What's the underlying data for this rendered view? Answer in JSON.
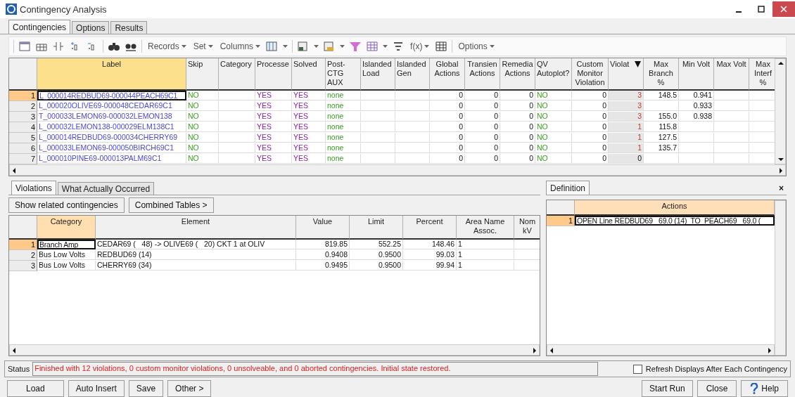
{
  "window": {
    "title": "Contingency Analysis"
  },
  "tabs": [
    {
      "label": "Contingencies",
      "selected": true
    },
    {
      "label": "Options",
      "selected": false
    },
    {
      "label": "Results",
      "selected": false
    }
  ],
  "toolbar": {
    "menus": [
      "Records",
      "Set",
      "Columns",
      "f(x)",
      "Options"
    ]
  },
  "contingencies": {
    "columns": [
      {
        "label": "Label",
        "kind": "label",
        "selected": true,
        "sorted": false
      },
      {
        "label": "Skip",
        "kind": "flag",
        "selected": false,
        "sorted": false
      },
      {
        "label": "Category",
        "kind": "text",
        "selected": false,
        "sorted": false
      },
      {
        "label": "Processe",
        "kind": "status",
        "selected": false,
        "sorted": false
      },
      {
        "label": "Solved",
        "kind": "status",
        "selected": false,
        "sorted": false
      },
      {
        "label": "Post-CTG AUX",
        "kind": "flag",
        "selected": false,
        "sorted": false
      },
      {
        "label": "Islanded Load",
        "kind": "text",
        "selected": false,
        "sorted": false
      },
      {
        "label": "Islanded Gen",
        "kind": "text",
        "selected": false,
        "sorted": false
      },
      {
        "label": "Global Actions",
        "kind": "num",
        "selected": false,
        "sorted": false
      },
      {
        "label": "Transien Actions",
        "kind": "num",
        "selected": false,
        "sorted": false
      },
      {
        "label": "Remedia Actions",
        "kind": "num",
        "selected": false,
        "sorted": false
      },
      {
        "label": "QV Autoplot?",
        "kind": "flag",
        "selected": false,
        "sorted": false
      },
      {
        "label": "Custom Monitor Violation",
        "kind": "num",
        "selected": false,
        "sorted": false
      },
      {
        "label": "Violat",
        "kind": "count",
        "selected": false,
        "sorted": true
      },
      {
        "label": "Max Branch %",
        "kind": "num",
        "selected": false,
        "sorted": false
      },
      {
        "label": "Min Volt",
        "kind": "num",
        "selected": false,
        "sorted": false
      },
      {
        "label": "Max Volt",
        "kind": "num",
        "selected": false,
        "sorted": false
      },
      {
        "label": "Max Interf %",
        "kind": "num",
        "selected": false,
        "sorted": false
      }
    ],
    "rows": [
      {
        "number": "1",
        "selected": true,
        "violated": true,
        "cells": [
          "L_000014REDBUD69-000044PEACH69C1",
          "NO",
          null,
          "YES",
          "YES",
          "none",
          null,
          null,
          "0",
          "0",
          "0",
          "NO",
          "0",
          "3",
          "148.5",
          "0.941",
          null,
          null
        ]
      },
      {
        "number": "2",
        "selected": false,
        "violated": true,
        "cells": [
          "L_000020OLIVE69-000048CEDAR69C1",
          "NO",
          null,
          "YES",
          "YES",
          "none",
          null,
          null,
          "0",
          "0",
          "0",
          "NO",
          "0",
          "3",
          null,
          "0.933",
          null,
          null
        ]
      },
      {
        "number": "3",
        "selected": false,
        "violated": true,
        "cells": [
          "T_000033LEMON69-000032LEMON138",
          "NO",
          null,
          "YES",
          "YES",
          "none",
          null,
          null,
          "0",
          "0",
          "0",
          "NO",
          "0",
          "3",
          "155.0",
          "0.938",
          null,
          null
        ]
      },
      {
        "number": "4",
        "selected": false,
        "violated": true,
        "cells": [
          "L_000032LEMON138-000029ELM138C1",
          "NO",
          null,
          "YES",
          "YES",
          "none",
          null,
          null,
          "0",
          "0",
          "0",
          "NO",
          "0",
          "1",
          "115.8",
          null,
          null,
          null
        ]
      },
      {
        "number": "5",
        "selected": false,
        "violated": true,
        "cells": [
          "L_000014REDBUD69-000034CHERRY69",
          "NO",
          null,
          "YES",
          "YES",
          "none",
          null,
          null,
          "0",
          "0",
          "0",
          "NO",
          "0",
          "1",
          "127.5",
          null,
          null,
          null
        ]
      },
      {
        "number": "6",
        "selected": false,
        "violated": true,
        "cells": [
          "L_000033LEMON69-000050BIRCH69C1",
          "NO",
          null,
          "YES",
          "YES",
          "none",
          null,
          null,
          "0",
          "0",
          "0",
          "NO",
          "0",
          "1",
          "135.7",
          null,
          null,
          null
        ]
      },
      {
        "number": "7",
        "selected": false,
        "violated": false,
        "cells": [
          "L_000010PINE69-000013PALM69C1",
          "NO",
          null,
          "YES",
          "YES",
          "none",
          null,
          null,
          "0",
          "0",
          "0",
          "NO",
          "0",
          "0",
          null,
          null,
          null,
          null
        ]
      }
    ]
  },
  "result_tabs": [
    {
      "label": "Violations",
      "selected": true
    },
    {
      "label": "What Actually Occurred",
      "selected": false
    }
  ],
  "violation_buttons": [
    "Show related contingencies",
    "Combined Tables >"
  ],
  "violations": {
    "columns": [
      {
        "label": "Category",
        "kind": "text",
        "selected": true
      },
      {
        "label": "Element",
        "kind": "text",
        "selected": false
      },
      {
        "label": "Value",
        "kind": "num",
        "selected": false
      },
      {
        "label": "Limit",
        "kind": "num",
        "selected": false
      },
      {
        "label": "Percent",
        "kind": "num",
        "selected": false
      },
      {
        "label": "Area Name Assoc.",
        "kind": "text",
        "selected": false
      },
      {
        "label": "Nom kV",
        "kind": "text",
        "selected": false
      }
    ],
    "rows": [
      {
        "number": "1",
        "selected": true,
        "cells": [
          "Branch Amp",
          "CEDAR69 (   48) -> OLIVE69 (   20) CKT 1 at OLIV",
          "819.85",
          "552.25",
          "148.46",
          "1",
          null
        ]
      },
      {
        "number": "2",
        "selected": false,
        "cells": [
          "Bus Low Volts",
          "REDBUD69 (14)",
          "0.9408",
          "0.9500",
          "99.03",
          "1",
          null
        ]
      },
      {
        "number": "3",
        "selected": false,
        "cells": [
          "Bus Low Volts",
          "CHERRY69 (34)",
          "0.9495",
          "0.9500",
          "99.94",
          "1",
          null
        ]
      }
    ]
  },
  "definition": {
    "tab": "Definition",
    "close": "×",
    "columns": [
      {
        "label": "Actions",
        "selected": true
      }
    ],
    "rows": [
      {
        "number": "1",
        "selected": true,
        "cells": [
          "OPEN Line REDBUD69   69.0 (14)  TO  PEACH69   69.0 ("
        ]
      }
    ]
  },
  "status": {
    "label": "Status",
    "message": "Finished with 12 violations, 0 custom monitor violations, 0 unsolveable, and 0 aborted contingencies. Initial state restored.",
    "refresh": {
      "label": "Refresh Displays After Each Contingency",
      "checked": false
    }
  },
  "buttons_left": [
    "Load",
    "Auto Insert",
    "Save",
    "Other >"
  ],
  "buttons_right": [
    "Start Run",
    "Close",
    "Help"
  ]
}
